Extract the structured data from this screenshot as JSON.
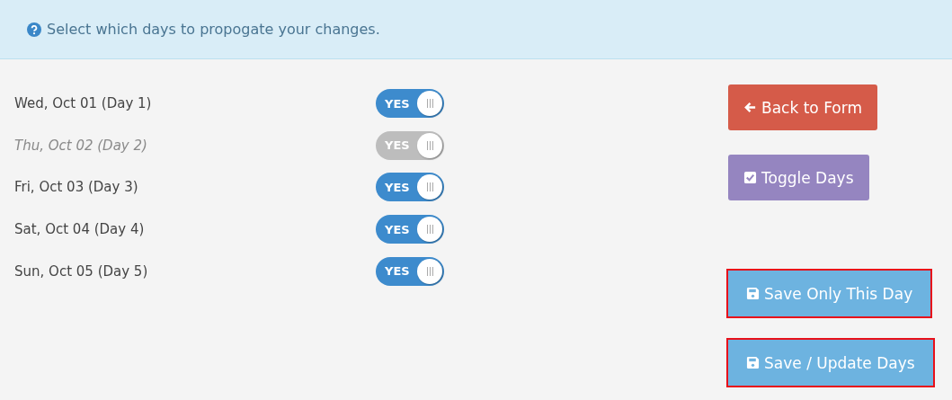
{
  "notice": {
    "text": "Select which days to propogate your changes."
  },
  "days": [
    {
      "label": "Wed, Oct 01 (Day 1)",
      "switch_text": "YES",
      "disabled": false
    },
    {
      "label": "Thu, Oct 02 (Day 2)",
      "switch_text": "YES",
      "disabled": true
    },
    {
      "label": "Fri, Oct 03 (Day 3)",
      "switch_text": "YES",
      "disabled": false
    },
    {
      "label": "Sat, Oct 04 (Day 4)",
      "switch_text": "YES",
      "disabled": false
    },
    {
      "label": "Sun, Oct 05 (Day 5)",
      "switch_text": "YES",
      "disabled": false
    }
  ],
  "buttons": [
    {
      "label": "Back to Form",
      "kind": "back",
      "highlighted": false
    },
    {
      "label": "Toggle Days",
      "kind": "toggle",
      "highlighted": false
    },
    {
      "label": "Save Only This Day",
      "kind": "save",
      "highlighted": true
    },
    {
      "label": "Save / Update Days",
      "kind": "save",
      "highlighted": true
    }
  ]
}
